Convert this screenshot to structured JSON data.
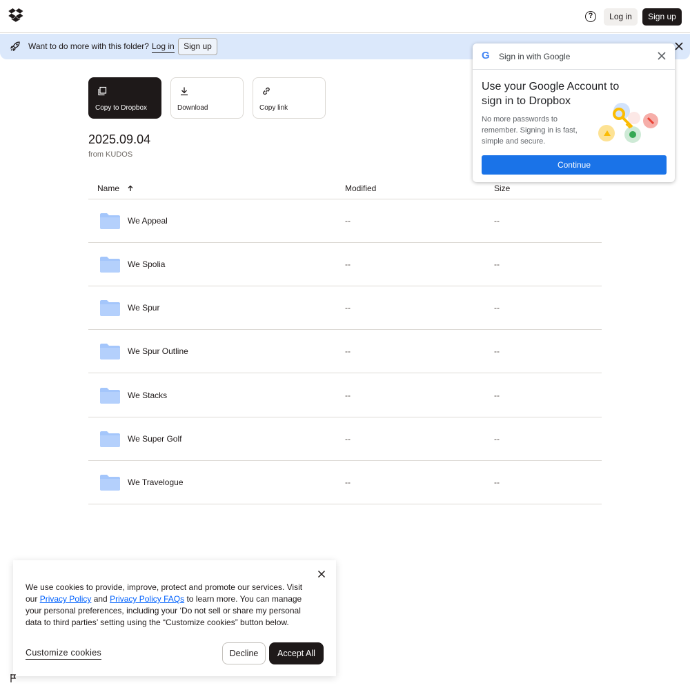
{
  "header": {
    "login_label": "Log in",
    "signup_label": "Sign up"
  },
  "banner": {
    "text": "Want to do more with this folder?",
    "login_label": "Log in",
    "signup_label": "Sign up"
  },
  "actions": [
    {
      "label": "Copy to Dropbox",
      "icon": "copy-icon"
    },
    {
      "label": "Download",
      "icon": "download-icon"
    },
    {
      "label": "Copy link",
      "icon": "link-icon"
    }
  ],
  "folder": {
    "title": "2025.09.04",
    "from": "from KUDOS"
  },
  "table": {
    "columns": [
      "Name",
      "Modified",
      "Size"
    ],
    "rows": [
      {
        "name": "We Appeal",
        "modified": "--",
        "size": "--"
      },
      {
        "name": "We Spolia",
        "modified": "--",
        "size": "--"
      },
      {
        "name": "We Spur",
        "modified": "--",
        "size": "--"
      },
      {
        "name": "We Spur Outline",
        "modified": "--",
        "size": "--"
      },
      {
        "name": "We Stacks",
        "modified": "--",
        "size": "--"
      },
      {
        "name": "We Super Golf",
        "modified": "--",
        "size": "--"
      },
      {
        "name": "We Travelogue",
        "modified": "--",
        "size": "--"
      }
    ]
  },
  "google_signin": {
    "logo": "G",
    "header": "Sign in with Google",
    "title": "Use your Google Account to sign in to Dropbox",
    "description": "No more passwords to remember. Signing in is fast, simple and secure.",
    "continue_label": "Continue"
  },
  "cookie": {
    "text_before": "We use cookies to provide, improve, protect and promote our services. Visit our ",
    "privacy_link": "Privacy Policy",
    "and": " and ",
    "faq_link": "Privacy Policy FAQs",
    "text_after": " to learn more. You can manage your personal preferences, including your ‘Do not sell or share my personal data to third parties’ setting using the “Customize cookies” button below.",
    "customize_label": "Customize cookies",
    "decline_label": "Decline",
    "accept_label": "Accept All"
  },
  "colors": {
    "accent_blue": "#0061fe",
    "google_blue": "#1a73e8",
    "banner_bg": "#dbe8fb",
    "folder_blue": "#a4c6fb",
    "dark": "#1e1919"
  }
}
